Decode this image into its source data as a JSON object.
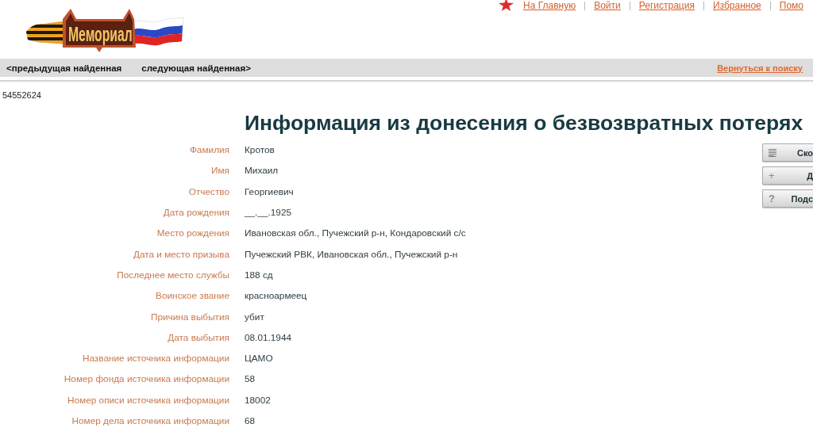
{
  "top_nav": {
    "links": [
      "На Главную",
      "Войти",
      "Регистрация",
      "Избранное",
      "Помо"
    ]
  },
  "logo": {
    "text": "Мемориал"
  },
  "nav_bar": {
    "prev": "<предыдущая найденная",
    "next": "следующая найденная>",
    "back": "Вернуться к поиску"
  },
  "record_id": "54552624",
  "title": "Информация из донесения о безвозвратных потерях",
  "fields": [
    {
      "label": "Фамилия",
      "value": "Кротов"
    },
    {
      "label": "Имя",
      "value": "Михаил"
    },
    {
      "label": "Отчество",
      "value": "Георгиевич"
    },
    {
      "label": "Дата рождения",
      "value": "__.__.1925"
    },
    {
      "label": "Место рождения",
      "value": "Ивановская обл., Пучежский р-н, Кондаровский с/с"
    },
    {
      "label": "Дата и место призыва",
      "value": "Пучежский РВК, Ивановская обл., Пучежский р-н"
    },
    {
      "label": "Последнее место службы",
      "value": "188 сд"
    },
    {
      "label": "Воинское звание",
      "value": "красноармеец"
    },
    {
      "label": "Причина выбытия",
      "value": "убит"
    },
    {
      "label": "Дата выбытия",
      "value": "08.01.1944"
    },
    {
      "label": "Название источника информации",
      "value": "ЦАМО"
    },
    {
      "label": "Номер фонда источника информации",
      "value": "58"
    },
    {
      "label": "Номер описи источника информации",
      "value": "18002"
    },
    {
      "label": "Номер дела источника информации",
      "value": "68"
    }
  ],
  "side_buttons": [
    {
      "kind": "lines",
      "label": "Ско"
    },
    {
      "kind": "plus",
      "symbol": "+",
      "label": "Д"
    },
    {
      "kind": "help",
      "symbol": "?",
      "label": "Подс"
    }
  ]
}
